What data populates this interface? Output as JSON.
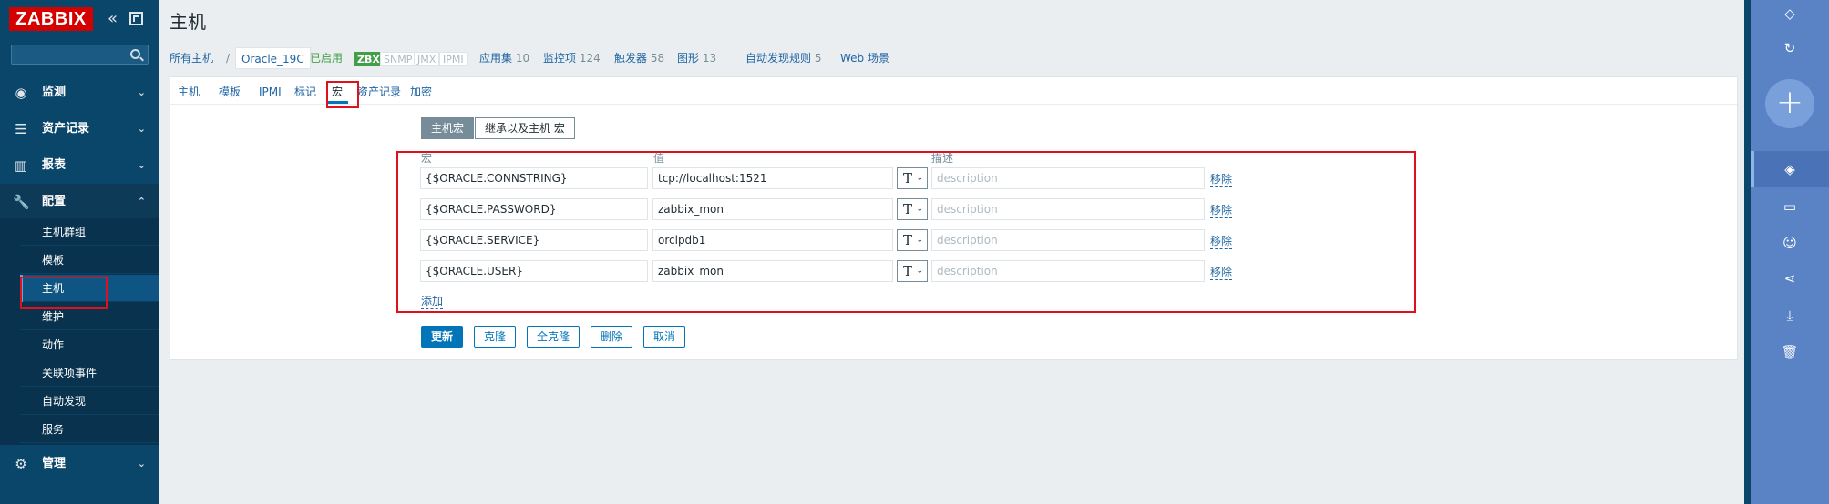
{
  "sidebar": {
    "logo": "ZABBIX",
    "collapse_icon": "double-chevron-left-icon",
    "kiosk_icon": "kiosk-mode-icon",
    "search_icon": "search-icon",
    "search_value": "",
    "menu": [
      {
        "label": "监测",
        "icon": "eye-icon"
      },
      {
        "label": "资产记录",
        "icon": "list-icon"
      },
      {
        "label": "报表",
        "icon": "bar-chart-icon"
      },
      {
        "label": "配置",
        "icon": "wrench-icon"
      },
      {
        "label": "管理",
        "icon": "gear-icon"
      }
    ],
    "submenu": [
      "主机群组",
      "模板",
      "主机",
      "维护",
      "动作",
      "关联项事件",
      "自动发现",
      "服务"
    ]
  },
  "page": {
    "title": "主机"
  },
  "breadcrumb": {
    "all_hosts": "所有主机",
    "sep": "/",
    "host": "Oracle_19C",
    "status": "已启用",
    "badges": [
      "ZBX",
      "SNMP",
      "JMX",
      "IPMI"
    ],
    "stats": [
      {
        "label": "应用集",
        "count": "10"
      },
      {
        "label": "监控项",
        "count": "124"
      },
      {
        "label": "触发器",
        "count": "58"
      },
      {
        "label": "图形",
        "count": "13"
      },
      {
        "label": "自动发现规则",
        "count": "5"
      },
      {
        "label": "Web 场景",
        "count": ""
      }
    ]
  },
  "tabs": [
    "主机",
    "模板",
    "IPMI",
    "标记",
    "宏",
    "资产记录",
    "加密"
  ],
  "macro_toggle": {
    "host": "主机宏",
    "inherited": "继承以及主机 宏"
  },
  "columns": {
    "macro": "宏",
    "value": "值",
    "description": "描述"
  },
  "macros": [
    {
      "macro": "{$ORACLE.CONNSTRING}",
      "value": "tcp://localhost:1521",
      "type": "T",
      "description_placeholder": "description",
      "remove": "移除"
    },
    {
      "macro": "{$ORACLE.PASSWORD}",
      "value": "zabbix_mon",
      "type": "T",
      "description_placeholder": "description",
      "remove": "移除"
    },
    {
      "macro": "{$ORACLE.SERVICE}",
      "value": "orclpdb1",
      "type": "T",
      "description_placeholder": "description",
      "remove": "移除"
    },
    {
      "macro": "{$ORACLE.USER}",
      "value": "zabbix_mon",
      "type": "T",
      "description_placeholder": "description",
      "remove": "移除"
    }
  ],
  "add_label": "添加",
  "buttons": {
    "update": "更新",
    "clone": "克隆",
    "full_clone": "全克隆",
    "delete": "删除",
    "cancel": "取消"
  },
  "rightbar": {
    "icons": [
      "diamond-icon",
      "refresh-icon",
      "plus-icon",
      "layers-icon",
      "folder-icon",
      "user-icon",
      "share-icon",
      "download-icon",
      "trash-icon"
    ]
  },
  "colors": {
    "sidebar": "#0a466a",
    "accent": "#0275b8",
    "highlight": "#e0111e",
    "enabled": "#429e47",
    "rightbar": "#5a83c6"
  }
}
